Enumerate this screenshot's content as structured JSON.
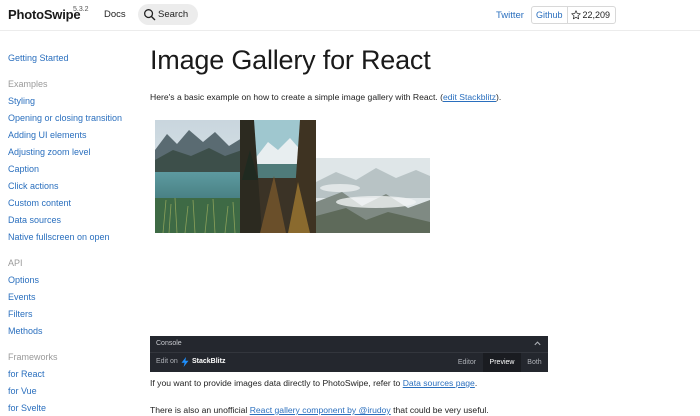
{
  "header": {
    "logo": "PhotoSwipe",
    "version": "5.3.2",
    "docs_link": "Docs",
    "search_label": "Search",
    "twitter_link": "Twitter",
    "github_label": "Github",
    "github_stars": "22,209"
  },
  "sidebar": {
    "getting_started": "Getting Started",
    "groups": [
      {
        "title": "Examples",
        "items": [
          "Styling",
          "Opening or closing transition",
          "Adding UI elements",
          "Adjusting zoom level",
          "Caption",
          "Click actions",
          "Custom content",
          "Data sources",
          "Native fullscreen on open"
        ]
      },
      {
        "title": "API",
        "items": [
          "Options",
          "Events",
          "Filters",
          "Methods"
        ]
      },
      {
        "title": "Frameworks",
        "items": [
          "for React",
          "for Vue",
          "for Svelte"
        ]
      }
    ]
  },
  "main": {
    "title": "Image Gallery for React",
    "intro_text": "Here's a basic example on how to create a simple image gallery with React. (",
    "intro_link": "edit Stackblitz",
    "intro_end": ").",
    "gallery": [
      {
        "name": "mountain-lake-photo"
      },
      {
        "name": "forest-mountain-photo"
      },
      {
        "name": "misty-valley-photo"
      }
    ],
    "console": {
      "label": "Console",
      "edit_on": "Edit on",
      "stackblitz": "StackBlitz",
      "tabs": [
        "Editor",
        "Preview",
        "Both"
      ],
      "active_tab": "Preview"
    },
    "para1_text": "If you want to provide images data directly to PhotoSwipe, refer to ",
    "para1_link": "Data sources page",
    "para1_end": ".",
    "para2_text": "There is also an unofficial ",
    "para2_link": "React gallery component by @irudoy",
    "para2_end": " that could be very useful."
  },
  "colors": {
    "link": "#2a6fbe",
    "console_bg": "#24272e",
    "muted": "#9a9a9a"
  }
}
